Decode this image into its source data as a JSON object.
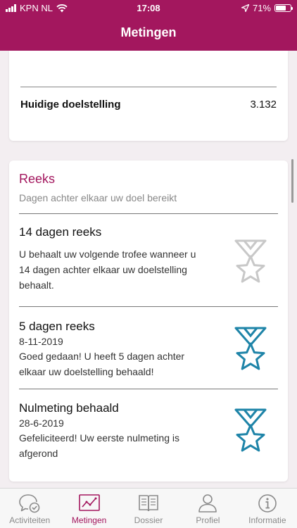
{
  "status": {
    "carrier": "KPN NL",
    "time": "17:08",
    "battery": "71%",
    "battery_level": 0.71
  },
  "header": {
    "title": "Metingen"
  },
  "goal": {
    "label": "Huidige doelstelling",
    "value": "3.132"
  },
  "streak": {
    "title": "Reeks",
    "subtitle": "Dagen achter elkaar uw doel bereikt",
    "items": [
      {
        "title": "14 dagen reeks",
        "date": "",
        "text_lines": [
          "U behaalt uw volgende trofee wanneer u",
          "14 dagen achter elkaar uw doelstelling",
          "behaalt."
        ],
        "achieved": false
      },
      {
        "title": "5 dagen reeks",
        "date": "8-11-2019",
        "text_lines": [
          "Goed gedaan! U heeft 5 dagen achter",
          "elkaar uw doelstelling behaald!"
        ],
        "achieved": true
      },
      {
        "title": "Nulmeting behaald",
        "date": "28-6-2019",
        "text_lines": [
          "Gefeliciteerd! Uw eerste nulmeting is",
          "afgerond"
        ],
        "achieved": true
      }
    ]
  },
  "tabs": [
    {
      "label": "Activiteiten",
      "icon": "chat-check-icon",
      "active": false
    },
    {
      "label": "Metingen",
      "icon": "chart-icon",
      "active": true
    },
    {
      "label": "Dossier",
      "icon": "book-icon",
      "active": false
    },
    {
      "label": "Profiel",
      "icon": "person-icon",
      "active": false
    },
    {
      "label": "Informatie",
      "icon": "info-icon",
      "active": false
    }
  ],
  "colors": {
    "brand": "#a3175e",
    "trophy_achieved": "#1e84a8",
    "trophy_locked": "#c8c8c8"
  }
}
